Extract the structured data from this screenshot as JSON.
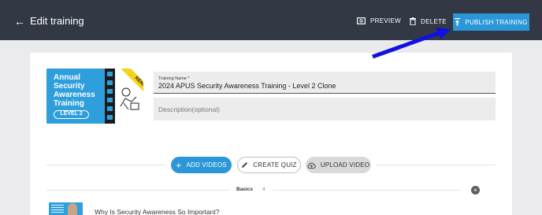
{
  "header": {
    "back_label": "Edit training",
    "preview_label": "PREVIEW",
    "delete_label": "DELETE",
    "publish_label": "PUBLISH TRAINING"
  },
  "thumbnail": {
    "title_lines": [
      "Annual",
      "Security",
      "Awareness",
      "Training"
    ],
    "level": "LEVEL 2",
    "ribbon": "RENAMED"
  },
  "form": {
    "name_label": "Training Name *",
    "name_value": "2024 APUS Security Awareness Training - Level 2  Clone",
    "description_placeholder": "Description(optional)"
  },
  "actions": {
    "add_videos": "ADD VIDEOS",
    "create_quiz": "CREATE QUIZ",
    "upload_video": "UPLOAD VIDEO"
  },
  "section": {
    "label": "Basics",
    "count": "4"
  },
  "videos": [
    {
      "title": "Why Is Security Awareness So Important?"
    }
  ],
  "colors": {
    "header_bg": "#323844",
    "accent": "#2b97d8",
    "thumbnail_bg": "#2e9fdc",
    "ribbon": "#f6d31a",
    "annotation_arrow": "#1010e0"
  }
}
